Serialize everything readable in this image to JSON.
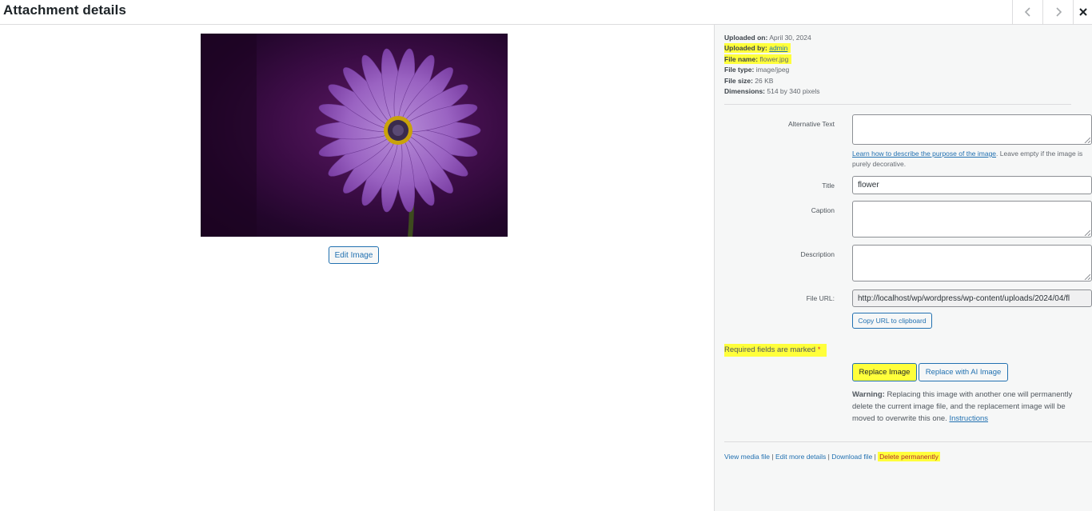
{
  "header": {
    "title": "Attachment details",
    "prev_icon": "chevron-left-icon",
    "next_icon": "chevron-right-icon",
    "close_icon": "close-icon"
  },
  "preview": {
    "edit_label": "Edit Image"
  },
  "meta": {
    "uploaded_on_label": "Uploaded on:",
    "uploaded_on": "April 30, 2024",
    "uploaded_by_label": "Uploaded by:",
    "uploaded_by": "admin",
    "file_name_label": "File name:",
    "file_name": "flower.jpg",
    "file_type_label": "File type:",
    "file_type": "image/jpeg",
    "file_size_label": "File size:",
    "file_size": "26 KB",
    "dimensions_label": "Dimensions:",
    "dimensions": "514 by 340 pixels"
  },
  "form": {
    "alt_label": "Alternative Text",
    "alt_value": "",
    "alt_help_link": "Learn how to describe the purpose of the image",
    "alt_help_text": ". Leave empty if the image is purely decorative.",
    "title_label": "Title",
    "title_value": "flower",
    "caption_label": "Caption",
    "caption_value": "",
    "description_label": "Description",
    "description_value": "",
    "url_label": "File URL:",
    "url_value": "http://localhost/wp/wordpress/wp-content/uploads/2024/04/fl",
    "copy_label": "Copy URL to clipboard"
  },
  "required": {
    "text": "Required fields are marked",
    "star": "*"
  },
  "replace": {
    "replace_label": "Replace Image",
    "ai_label": "Replace with AI Image",
    "warning_label": "Warning:",
    "warning_text": " Replacing this image with another one will permanently delete the current image file, and the replacement image will be moved to overwrite this one. ",
    "instructions_link": "Instructions"
  },
  "actions": {
    "view": "View media file",
    "edit_more": "Edit more details",
    "download": "Download file",
    "delete": "Delete permanently",
    "separator": " | "
  },
  "colors": {
    "accent": "#2271b1",
    "highlight": "#ffff3b",
    "danger": "#b32d2e",
    "panel_bg": "#f6f7f7"
  }
}
